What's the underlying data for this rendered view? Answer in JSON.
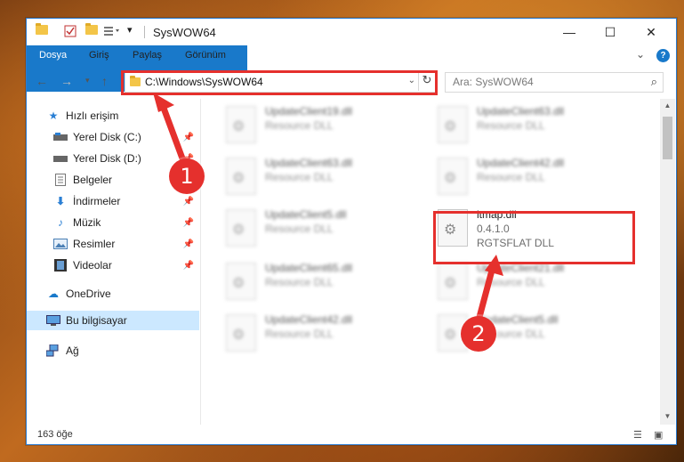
{
  "window": {
    "title": "SysWOW64",
    "quick_access_dropdown": "▾",
    "minimize": "—",
    "maximize": "☐",
    "close": "✕"
  },
  "ribbon": {
    "tabs": [
      "Dosya",
      "Giriş",
      "Paylaş",
      "Görünüm"
    ],
    "collapse": "⌄",
    "help": "?"
  },
  "address": {
    "path": "C:\\Windows\\SysWOW64",
    "search_placeholder": "Ara: SysWOW64"
  },
  "sidebar": {
    "quick_access": "Hızlı erişim",
    "items": [
      {
        "label": "Yerel Disk (C:)",
        "pinned": true
      },
      {
        "label": "Yerel Disk (D:)",
        "pinned": true
      },
      {
        "label": "Belgeler",
        "pinned": true
      },
      {
        "label": "İndirmeler",
        "pinned": true
      },
      {
        "label": "Müzik",
        "pinned": true
      },
      {
        "label": "Resimler",
        "pinned": true
      },
      {
        "label": "Videolar",
        "pinned": true
      }
    ],
    "onedrive": "OneDrive",
    "this_pc": "Bu bilgisayar",
    "network": "Ağ"
  },
  "files": [
    {
      "name": "UpdateClient19.dll",
      "desc": "Resource DLL"
    },
    {
      "name": "UpdateClient63.dll",
      "desc": "Resource DLL"
    },
    {
      "name": "UpdateClient63.dll",
      "desc": "Resource DLL"
    },
    {
      "name": "UpdateClient42.dll",
      "desc": "Resource DLL"
    },
    {
      "name": "UpdateClient5.dll",
      "desc": "Resource DLL"
    },
    {
      "name": "itmap.dll",
      "version": "0.4.1.0",
      "desc": "RGTSFLAT DLL"
    },
    {
      "name": "UpdateClient65.dll",
      "desc": "Resource DLL"
    },
    {
      "name": "UpdateClient21.dll",
      "desc": "Resource DLL"
    },
    {
      "name": "UpdateClient42.dll",
      "desc": "Resource DLL"
    },
    {
      "name": "UpdateClient5.dll",
      "desc": "Resource DLL"
    }
  ],
  "status": {
    "item_count": "163 öğe"
  },
  "annotations": {
    "step1": "1",
    "step2": "2",
    "color": "#e5302d"
  }
}
